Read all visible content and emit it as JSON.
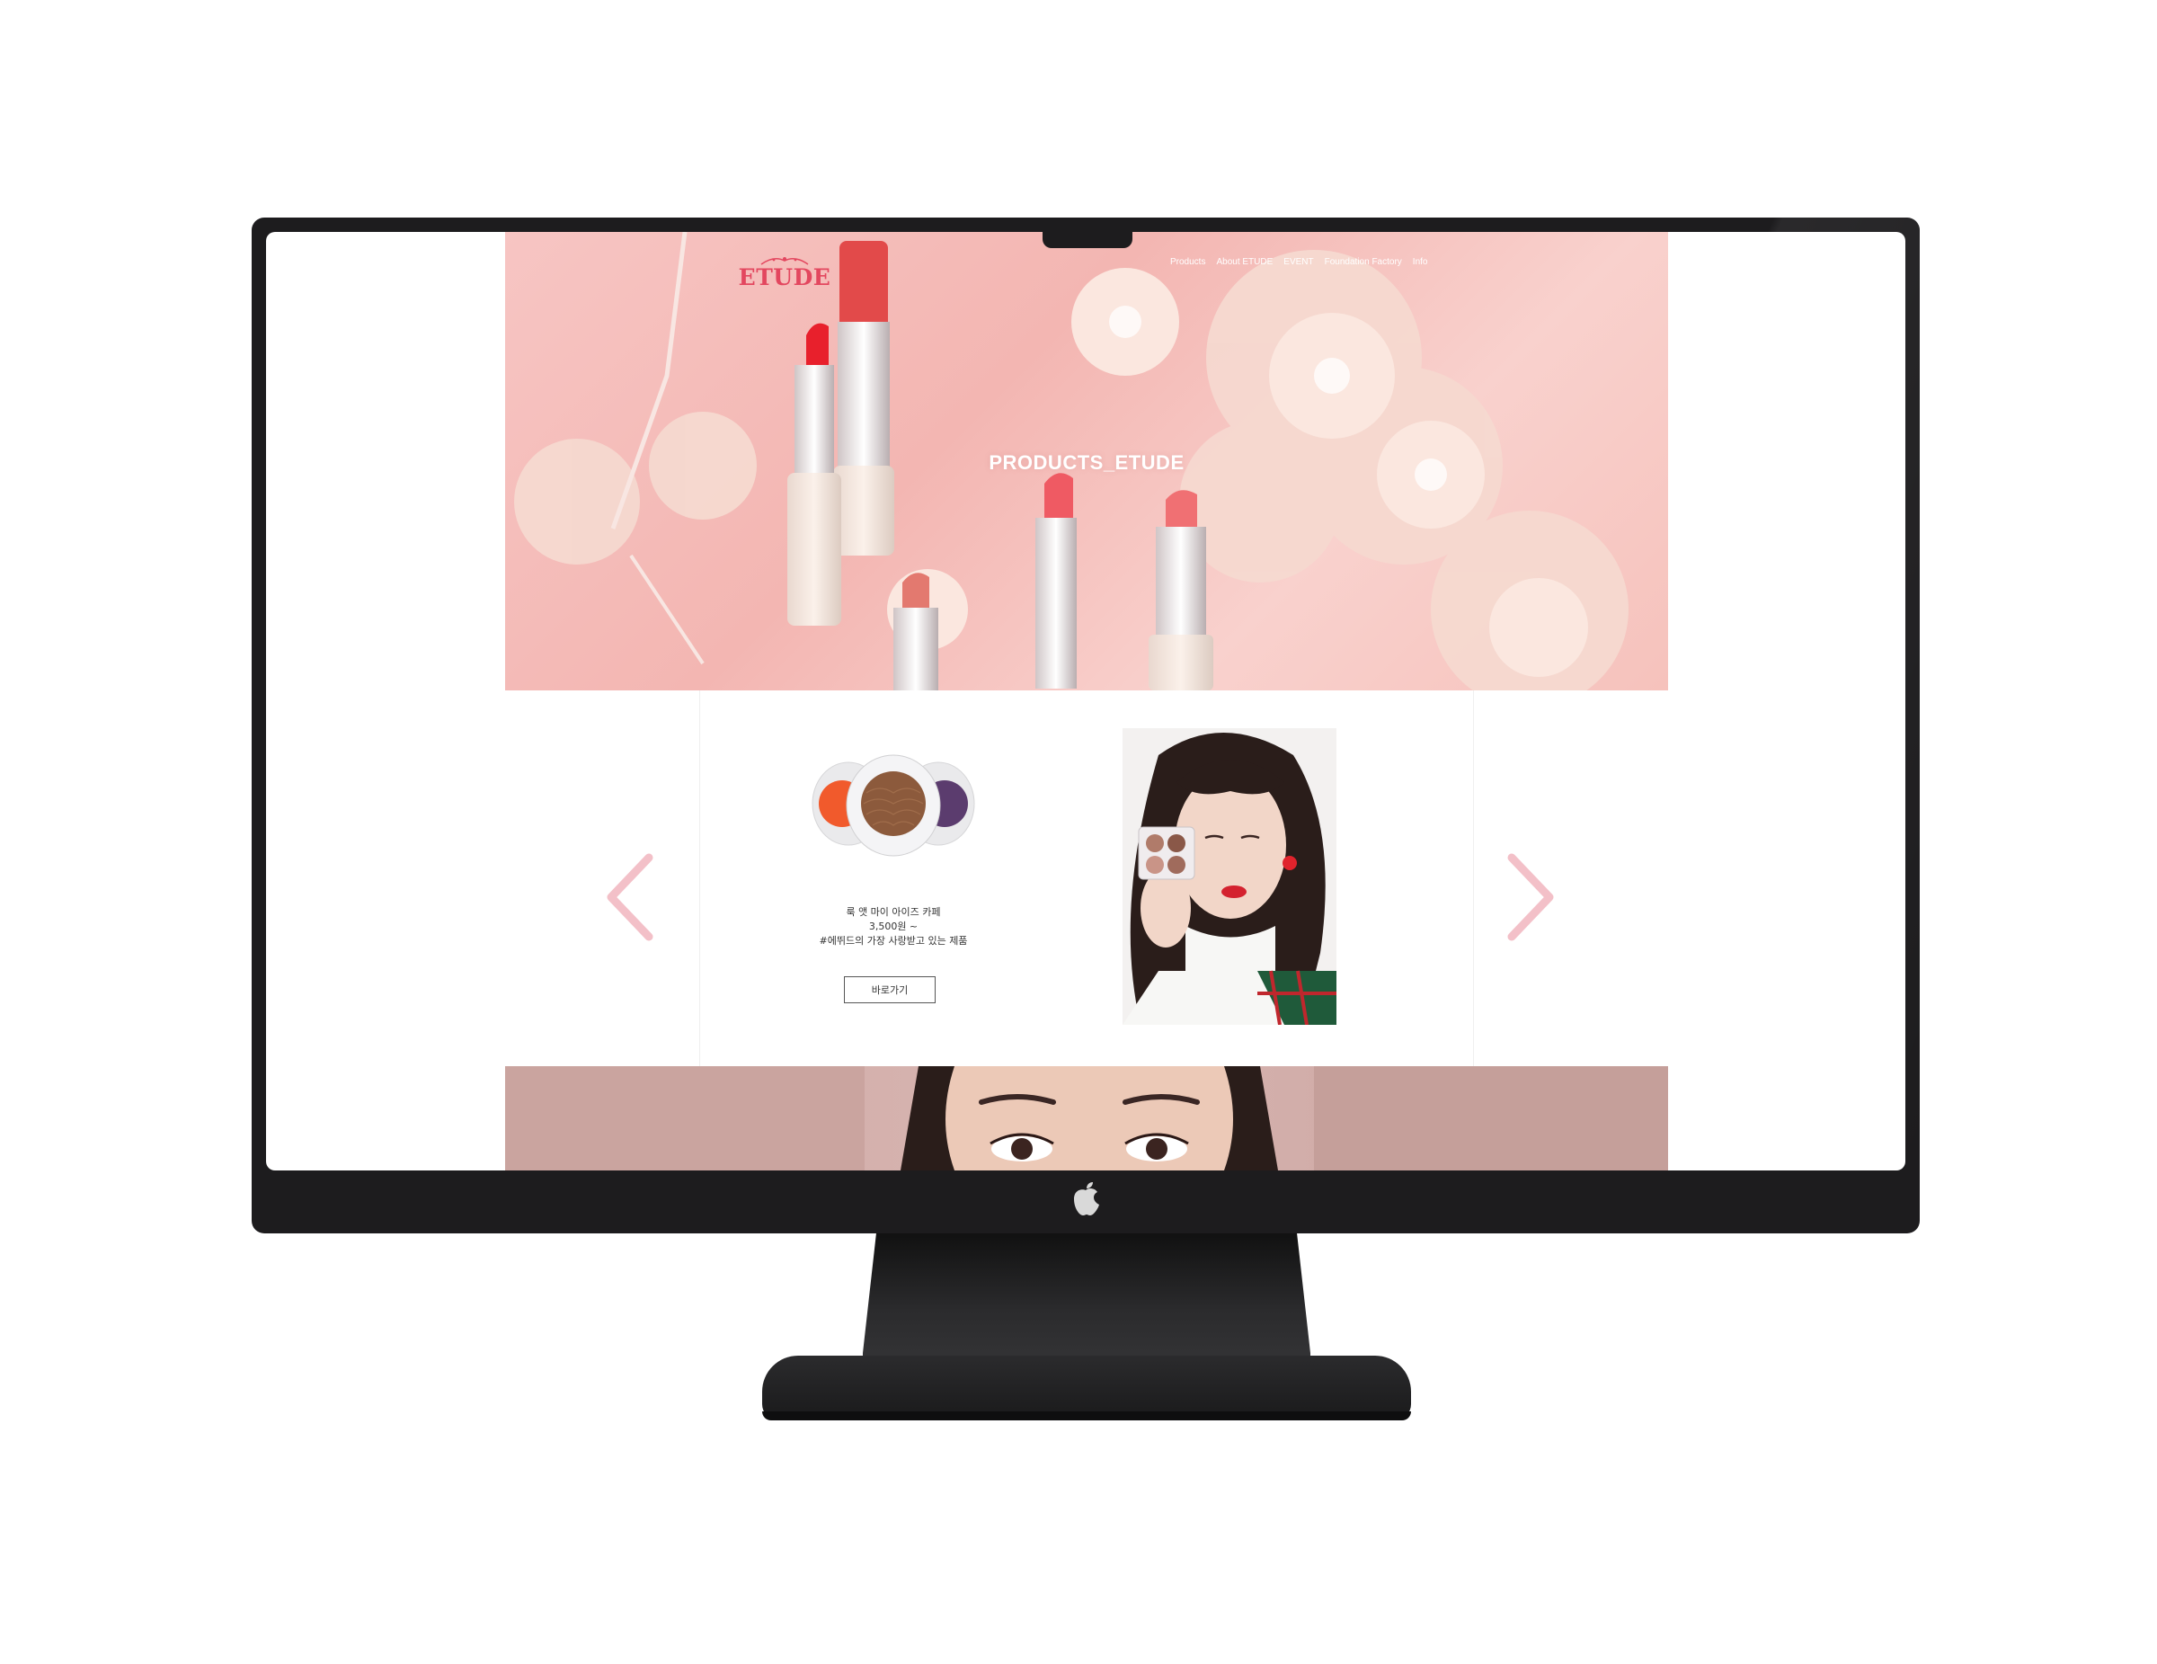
{
  "site": {
    "logo_text": "ETUDE",
    "nav": [
      "Products",
      "About ETUDE",
      "EVENT",
      "Foundation Factory",
      "Info"
    ]
  },
  "hero": {
    "title": "PRODUCTS_ETUDE"
  },
  "product": {
    "name": "룩 앳 마이 아이즈 카페",
    "price": "3,500원 ~",
    "tag": "#에뛰드의 가장 사랑받고 있는 제품",
    "button_label": "바로가기"
  },
  "icons": {
    "logo": "crown-icon",
    "prev": "chevron-left-icon",
    "next": "chevron-right-icon",
    "device": "apple-logo-icon"
  },
  "colors": {
    "brand": "#e3475f",
    "hero_bg": "#f7c5c3",
    "arrow": "#f3c0c8",
    "frame": "#1d1c1e"
  }
}
